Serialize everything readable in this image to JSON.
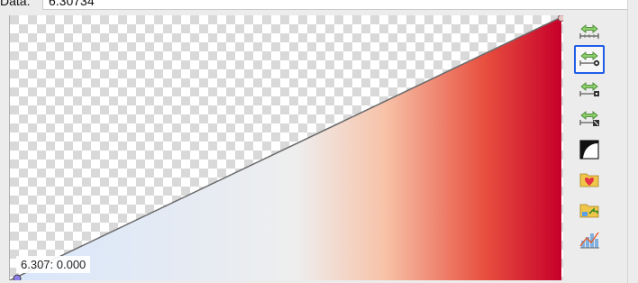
{
  "data_field": {
    "label": "Data:",
    "value": "6.30734"
  },
  "point_readout": "6.307: 0.000",
  "gradient": {
    "stops": [
      "#d8e6fb",
      "#eeeeee",
      "#f7c2a8",
      "#e8503f",
      "#c6002a"
    ]
  },
  "line_color": "#6a6a6a",
  "toolbar": [
    {
      "icon": "scale-range-icon",
      "selected": false
    },
    {
      "icon": "scale-range-to-data-icon",
      "selected": true
    },
    {
      "icon": "scale-range-to-visible-icon",
      "selected": false
    },
    {
      "icon": "scale-range-to-selection-icon",
      "selected": false
    },
    {
      "icon": "invert-opacity-icon",
      "selected": false
    },
    {
      "icon": "favorite-preset-icon",
      "selected": false
    },
    {
      "icon": "preset-folder-icon",
      "selected": false
    },
    {
      "icon": "show-histogram-icon",
      "selected": false
    }
  ],
  "selection_color": "#1f5de8"
}
